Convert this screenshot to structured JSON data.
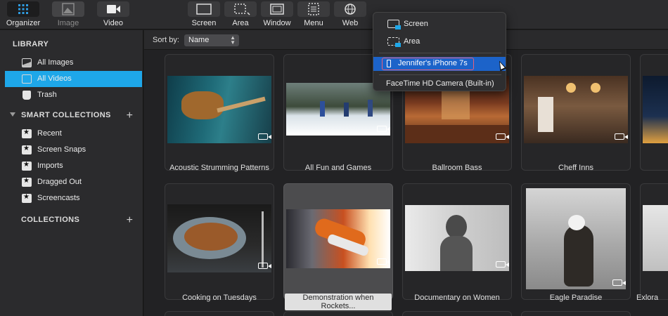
{
  "toolbar": {
    "buttons": [
      {
        "label": "Organizer",
        "icon": "grid-icon"
      },
      {
        "label": "Image",
        "icon": "image-icon"
      },
      {
        "label": "Video",
        "icon": "video-camera-icon"
      },
      {
        "label": "Screen",
        "icon": "screen-capture-icon"
      },
      {
        "label": "Area",
        "icon": "area-capture-icon"
      },
      {
        "label": "Window",
        "icon": "window-capture-icon"
      },
      {
        "label": "Menu",
        "icon": "menu-capture-icon"
      },
      {
        "label": "Web",
        "icon": "globe-icon"
      }
    ]
  },
  "sidebar": {
    "library_header": "LIBRARY",
    "library_items": [
      {
        "label": "All Images",
        "icon": "image-icon"
      },
      {
        "label": "All Videos",
        "icon": "film-icon",
        "selected": true
      },
      {
        "label": "Trash",
        "icon": "trash-icon"
      }
    ],
    "smart_header": "SMART COLLECTIONS",
    "smart_items": [
      {
        "label": "Recent",
        "icon": "star-folder-icon"
      },
      {
        "label": "Screen Snaps",
        "icon": "star-folder-icon"
      },
      {
        "label": "Imports",
        "icon": "star-folder-icon"
      },
      {
        "label": "Dragged Out",
        "icon": "star-folder-icon"
      },
      {
        "label": "Screencasts",
        "icon": "star-folder-icon"
      }
    ],
    "collections_header": "COLLECTIONS",
    "plus": "+"
  },
  "sortbar": {
    "label": "Sort by:",
    "value": "Name"
  },
  "grid": {
    "row1": [
      "Acoustic Strumming Patterns",
      "All Fun and Games",
      "Ballroom Bass",
      "Cheff Inns"
    ],
    "row2": [
      "Cooking on Tuesdays",
      "Demonstration when Rockets...",
      "Documentary on Women",
      "Eagle Paradise",
      "Exlora"
    ]
  },
  "popup": {
    "items": [
      "Screen",
      "Area",
      "Jennifer's iPhone 7s",
      "FaceTime HD Camera (Built-in)"
    ]
  },
  "colors": {
    "accent": "#1ea7e9",
    "menu_selection": "#1c63c9",
    "highlight_ring": "#e8607a"
  }
}
